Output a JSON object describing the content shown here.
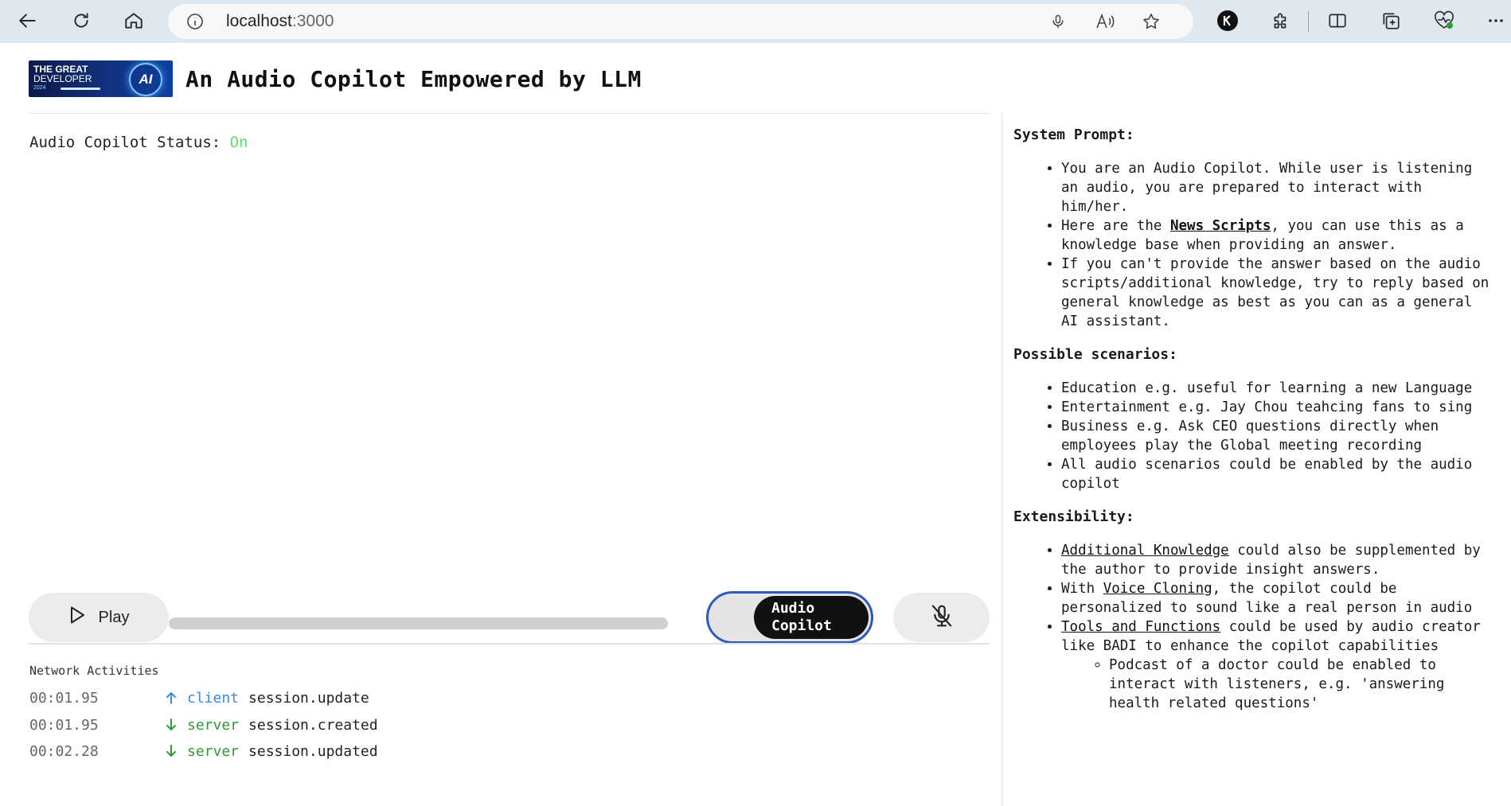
{
  "browser": {
    "url_host": "localhost",
    "url_port": ":3000"
  },
  "header": {
    "logo": {
      "line1": "THE GREAT",
      "line2": "DEVELOPER",
      "line3": "2024",
      "ai": "AI"
    },
    "title": "An Audio Copilot Empowered by LLM"
  },
  "status": {
    "label": "Audio Copilot Status:",
    "value": "On",
    "value_color": "#66d96a"
  },
  "controls": {
    "play_label": "Play",
    "toggle_label_line1": "Audio",
    "toggle_label_line2": "Copilot",
    "toggle_state": "on",
    "toggle_border_color": "#2d5bb8"
  },
  "network": {
    "title": "Network Activities",
    "rows": [
      {
        "time": "00:01.95",
        "direction": "up",
        "source": "client",
        "event": "session.update"
      },
      {
        "time": "00:01.95",
        "direction": "down",
        "source": "server",
        "event": "session.created"
      },
      {
        "time": "00:02.28",
        "direction": "down",
        "source": "server",
        "event": "session.updated"
      }
    ]
  },
  "panel": {
    "system_prompt": {
      "heading": "System Prompt:",
      "item1": "You are an Audio Copilot. While user is listening an audio, you are prepared to interact with him/her.",
      "item2_pre": "Here are the ",
      "item2_link": "News Scripts",
      "item2_post": ", you can use this as a knowledge base when providing an answer.",
      "item3": "If you can't provide the answer based on the audio scripts/additional knowledge, try to reply based on general knowledge as best as you can as a general AI assistant."
    },
    "scenarios": {
      "heading": "Possible scenarios:",
      "items": [
        "Education e.g. useful for learning a new Language",
        "Entertainment e.g. Jay Chou teahcing fans to sing",
        "Business e.g. Ask CEO questions directly when employees play the Global meeting recording",
        "All audio scenarios could be enabled by the audio copilot"
      ]
    },
    "extensibility": {
      "heading": "Extensibility:",
      "item1_link": "Additional Knowledge",
      "item1_post": " could also be supplemented by the author to provide insight answers.",
      "item2_pre": "With ",
      "item2_link": "Voice Cloning",
      "item2_post": ", the copilot could be personalized to sound like a real person in audio",
      "item3_link": "Tools and Functions",
      "item3_post": " could be used by audio creator like BADI to enhance the copilot capabilities",
      "subitem": "Podcast of a doctor could be enabled to interact with listeners, e.g. 'answering health related questions'"
    }
  },
  "icons": {
    "back": "back-arrow-icon",
    "refresh": "refresh-icon",
    "home": "home-icon",
    "info": "info-icon",
    "mic": "microphone-icon",
    "read_aloud": "read-aloud-icon",
    "favorite": "star-icon",
    "profile": "k-profile-icon",
    "extensions": "puzzle-icon",
    "split": "split-screen-icon",
    "collections": "collections-icon",
    "performance": "heart-pulse-icon",
    "more": "more-dots-icon",
    "play": "play-icon",
    "mic_off": "mic-off-icon"
  }
}
